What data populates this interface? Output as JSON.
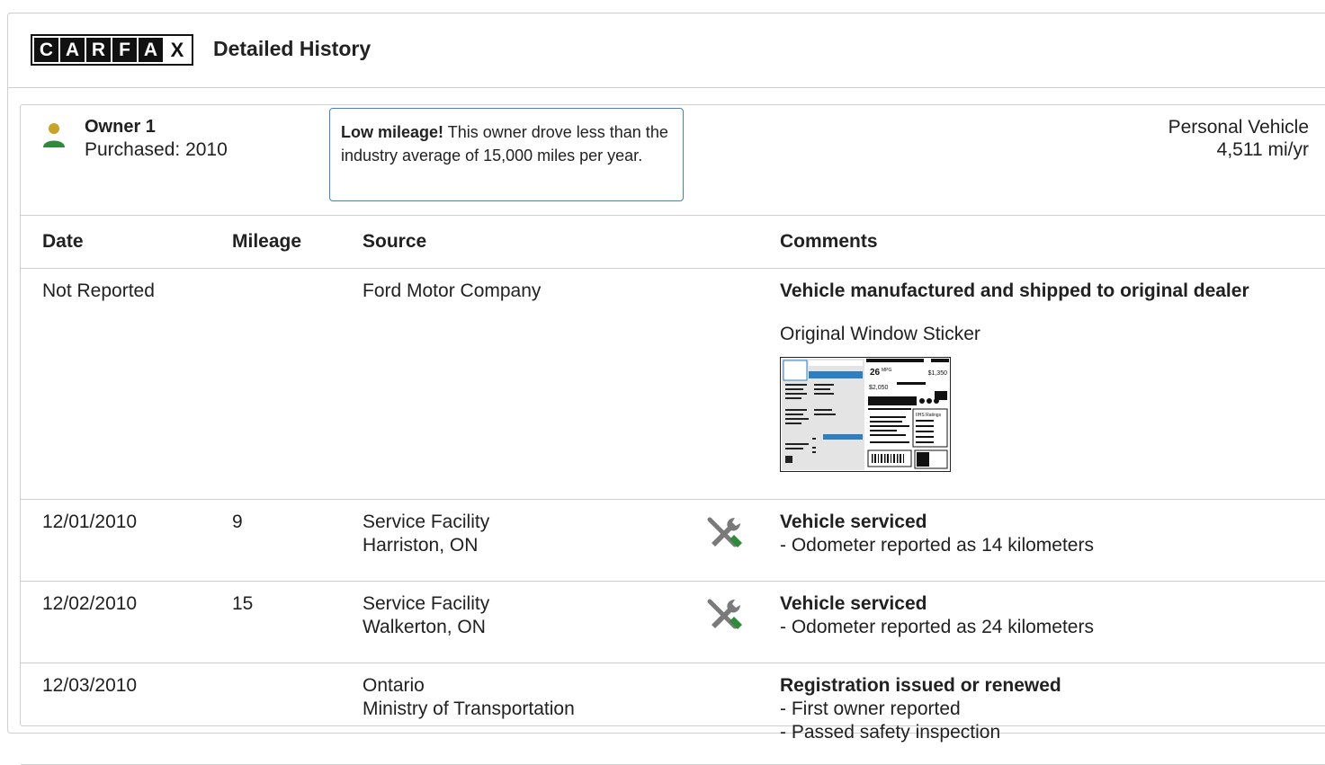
{
  "header": {
    "logo_letters": [
      "C",
      "A",
      "R",
      "F",
      "A",
      "X"
    ],
    "title": "Detailed History"
  },
  "owner": {
    "name": "Owner 1",
    "purchased": "Purchased: 2010",
    "callout_bold": "Low mileage!",
    "callout_text": " This owner drove less than the industry average of 15,000 miles per year.",
    "vehicle_type": "Personal Vehicle",
    "mileage_rate": "4,511 mi/yr",
    "icon_color": "#2e8b3a",
    "icon_head_color": "#c9a227"
  },
  "table": {
    "headers": {
      "date": "Date",
      "mileage": "Mileage",
      "source": "Source",
      "comments": "Comments"
    },
    "rows": [
      {
        "date": "Not Reported",
        "mileage": "",
        "source_line1": "Ford Motor Company",
        "source_line2": "",
        "icon": "",
        "comment_title": "Vehicle manufactured and shipped to original dealer",
        "comment_lines": [],
        "sticker_label": "Original Window Sticker"
      },
      {
        "date": "12/01/2010",
        "mileage": "9",
        "source_line1": "Service Facility",
        "source_line2": "Harriston, ON",
        "icon": "service-tools-icon",
        "comment_title": "Vehicle serviced",
        "comment_lines": [
          "- Odometer reported as 14 kilometers"
        ]
      },
      {
        "date": "12/02/2010",
        "mileage": "15",
        "source_line1": "Service Facility",
        "source_line2": "Walkerton, ON",
        "icon": "service-tools-icon",
        "comment_title": "Vehicle serviced",
        "comment_lines": [
          "- Odometer reported as 24 kilometers"
        ]
      },
      {
        "date": "12/03/2010",
        "mileage": "",
        "source_line1": "Ontario",
        "source_line2": "Ministry of Transportation",
        "icon": "",
        "comment_title": "Registration issued or renewed",
        "comment_lines": [
          "- First owner reported",
          "- Passed safety inspection"
        ]
      }
    ]
  },
  "sticker": {
    "mpg": "26",
    "mpg_unit": "MPG",
    "fuel_cost": "$1,350",
    "savings": "$2,050",
    "ratings_label": "IIHS Ratings"
  },
  "colors": {
    "accent_blue": "#3a86c8",
    "wrench_gray": "#7a7a7a",
    "screwdriver_green": "#2e8b3a",
    "border": "#cfcfcf"
  }
}
